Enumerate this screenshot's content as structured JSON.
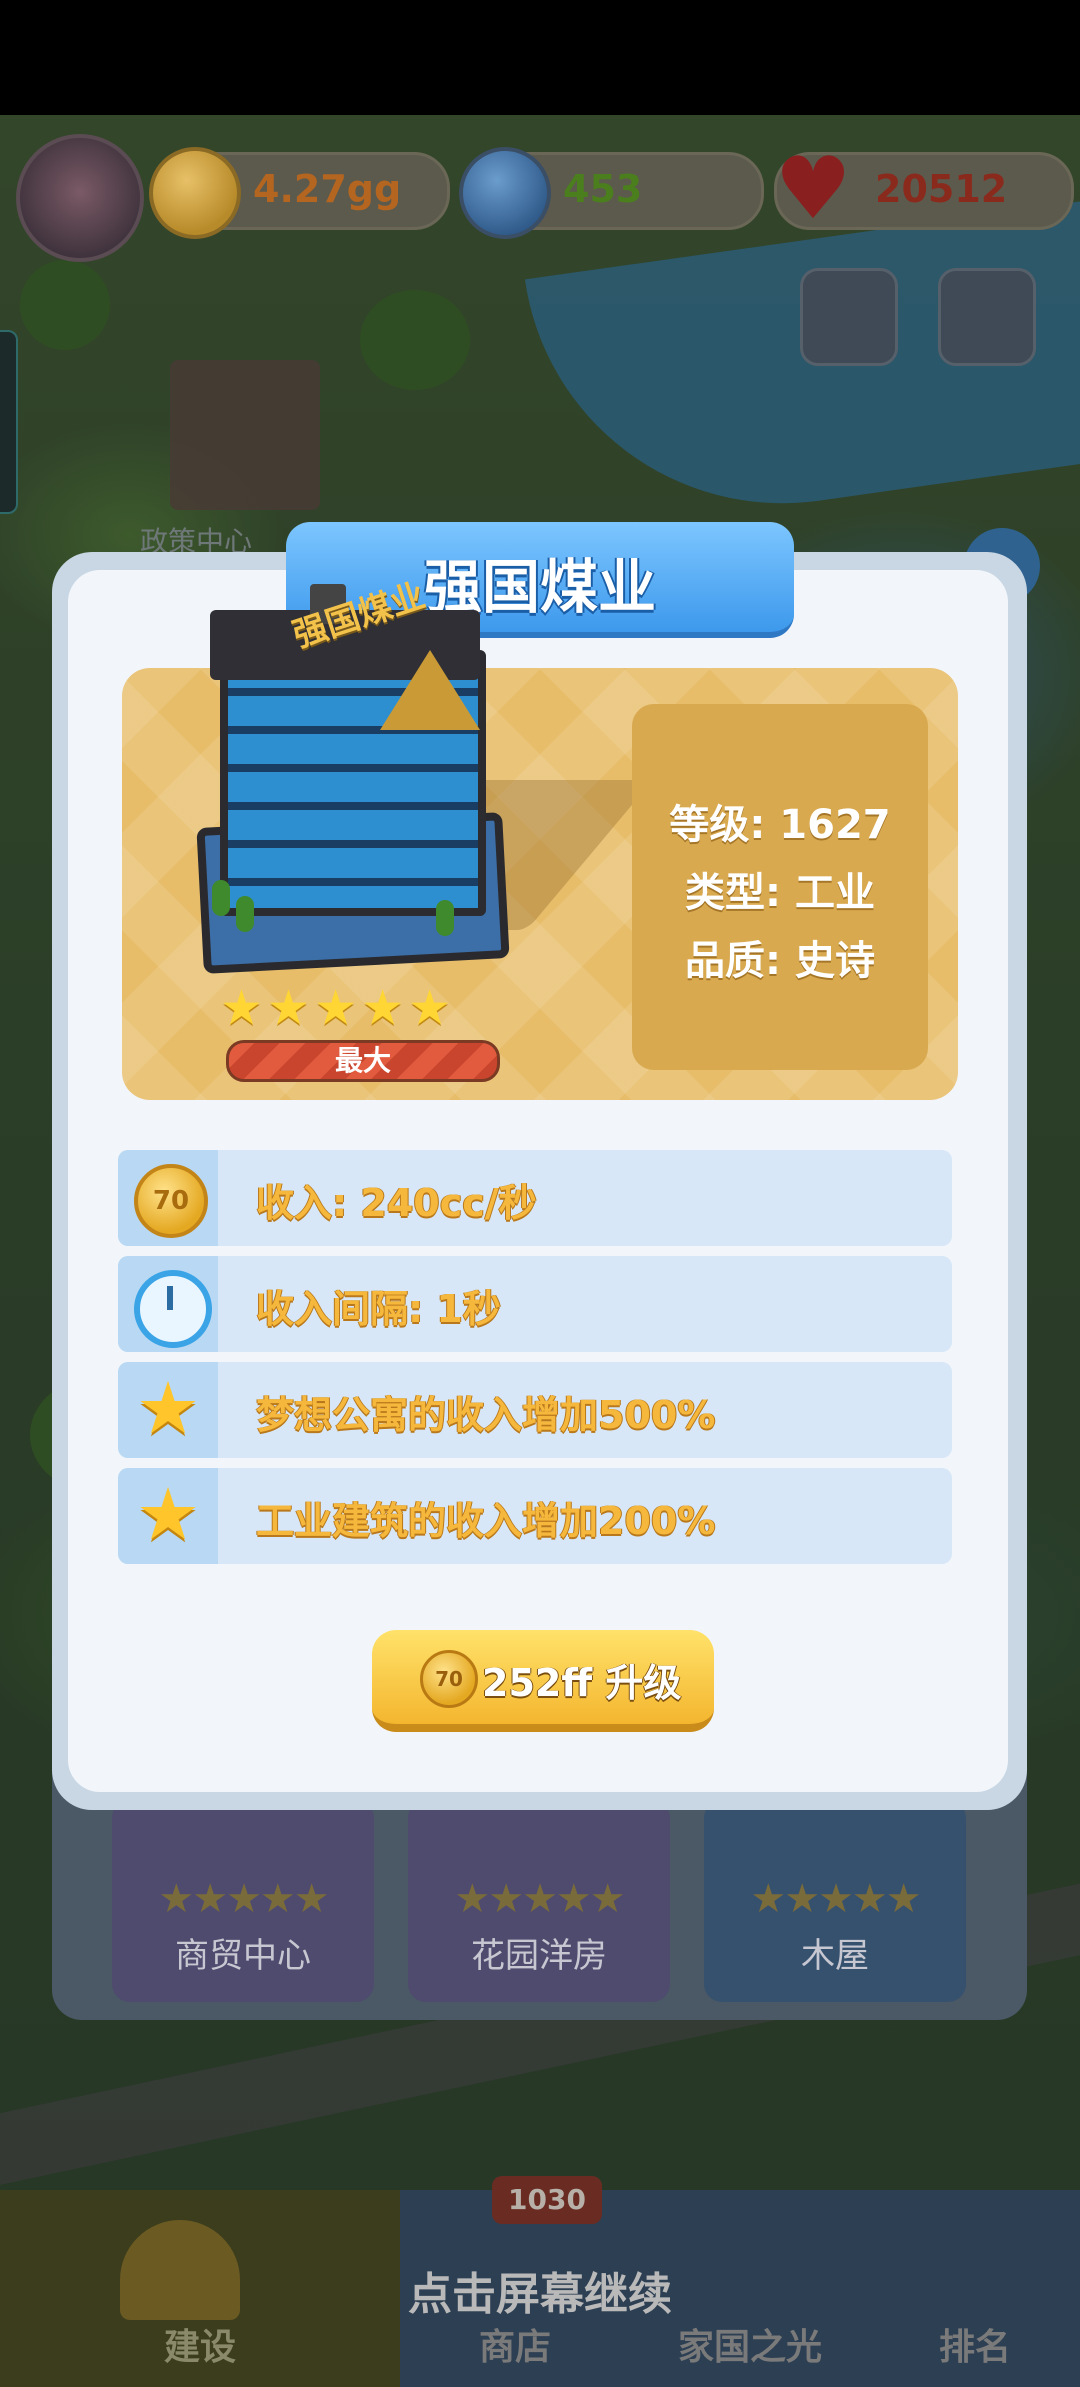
{
  "hud": {
    "coins": "4.27gg",
    "stars": "453",
    "hearts": "20512"
  },
  "background": {
    "building_label": "政策中心"
  },
  "modal": {
    "title": "强国煤业",
    "building_sign": "强国煤业",
    "stats": {
      "level": "等级: 1627",
      "type": "类型: 工业",
      "quality": "品质: 史诗"
    },
    "star_count": 5,
    "max_label": "最大",
    "rows": [
      {
        "icon": "coin-icon",
        "text": "收入: 240cc/秒"
      },
      {
        "icon": "clock-icon",
        "text": "收入间隔: 1秒"
      },
      {
        "icon": "star-icon",
        "text": "梦想公寓的收入增加500%"
      },
      {
        "icon": "star-icon",
        "text": "工业建筑的收入增加200%"
      }
    ],
    "upgrade_button": "252ff 升级"
  },
  "building_cards": [
    {
      "name": "商贸中心",
      "stars": 5
    },
    {
      "name": "花园洋房",
      "stars": 5
    },
    {
      "name": "木屋",
      "stars": 5
    }
  ],
  "nav": {
    "build": "建设",
    "shop": "商店",
    "shop_badge": "1030",
    "home_light": "家国之光",
    "rank": "排名"
  },
  "overlay_hint": "点击屏幕继续"
}
